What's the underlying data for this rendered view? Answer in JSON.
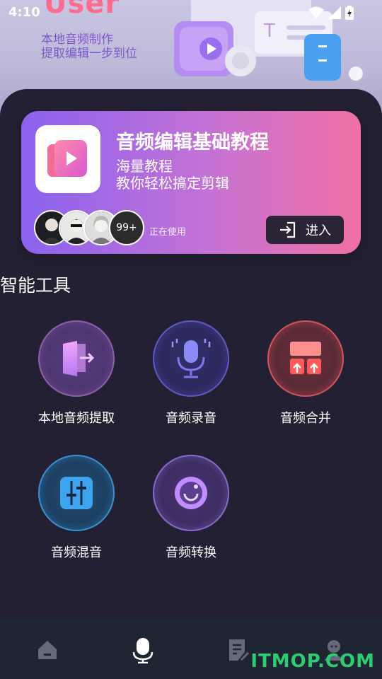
{
  "status": {
    "time": "4:10"
  },
  "hero": {
    "title": "User",
    "subtitle_line1": "本地音频制作",
    "subtitle_line2": "提取编辑一步到位"
  },
  "tutorial_card": {
    "title": "音频编辑基础教程",
    "desc_line1": "海量教程",
    "desc_line2": "教你轻松搞定剪辑",
    "avatar_more": "99+",
    "using_text": "正在使用",
    "enter_label": "进入"
  },
  "tools_section": {
    "title": "智能工具",
    "items": [
      {
        "label": "本地音频提取",
        "icon": "exit-door-icon"
      },
      {
        "label": "音频录音",
        "icon": "microphone-icon"
      },
      {
        "label": "音频合并",
        "icon": "merge-icon"
      },
      {
        "label": "音频混音",
        "icon": "mixer-sliders-icon"
      },
      {
        "label": "音频转换",
        "icon": "convert-circle-icon"
      }
    ]
  },
  "bottom_nav": {
    "items": [
      {
        "icon": "home-icon",
        "active": false
      },
      {
        "icon": "microphone-icon",
        "active": true
      },
      {
        "icon": "document-edit-icon",
        "active": false
      },
      {
        "icon": "user-icon",
        "active": false
      }
    ]
  },
  "watermark": "ITMOP.COM",
  "colors": {
    "background": "#242033",
    "card_gradient_start": "#8b62ef",
    "card_gradient_end": "#f070a4",
    "watermark": "#2ecc71"
  }
}
